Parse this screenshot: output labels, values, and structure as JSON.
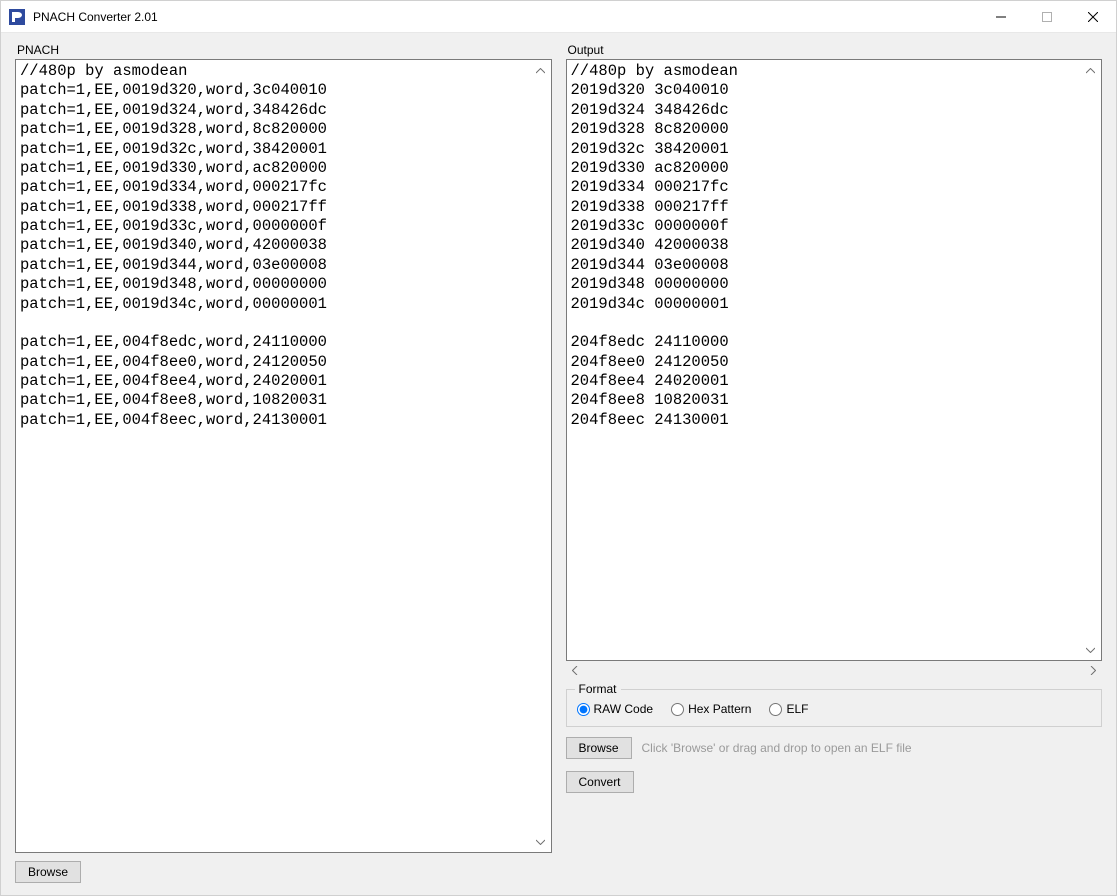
{
  "window": {
    "title": "PNACH Converter 2.01"
  },
  "labels": {
    "pnach": "PNACH",
    "output": "Output"
  },
  "format": {
    "legend": "Format",
    "options": {
      "raw": "RAW Code",
      "hex": "Hex Pattern",
      "elf": "ELF"
    },
    "selected": "raw"
  },
  "elf": {
    "browse": "Browse",
    "hint": "Click 'Browse' or drag and drop to open an ELF file"
  },
  "buttons": {
    "browse_left": "Browse",
    "convert": "Convert"
  },
  "pnach_text": "//480p by asmodean\npatch=1,EE,0019d320,word,3c040010\npatch=1,EE,0019d324,word,348426dc\npatch=1,EE,0019d328,word,8c820000\npatch=1,EE,0019d32c,word,38420001\npatch=1,EE,0019d330,word,ac820000\npatch=1,EE,0019d334,word,000217fc\npatch=1,EE,0019d338,word,000217ff\npatch=1,EE,0019d33c,word,0000000f\npatch=1,EE,0019d340,word,42000038\npatch=1,EE,0019d344,word,03e00008\npatch=1,EE,0019d348,word,00000000\npatch=1,EE,0019d34c,word,00000001\n\npatch=1,EE,004f8edc,word,24110000\npatch=1,EE,004f8ee0,word,24120050\npatch=1,EE,004f8ee4,word,24020001\npatch=1,EE,004f8ee8,word,10820031\npatch=1,EE,004f8eec,word,24130001",
  "output_text": "//480p by asmodean\n2019d320 3c040010\n2019d324 348426dc\n2019d328 8c820000\n2019d32c 38420001\n2019d330 ac820000\n2019d334 000217fc\n2019d338 000217ff\n2019d33c 0000000f\n2019d340 42000038\n2019d344 03e00008\n2019d348 00000000\n2019d34c 00000001\n\n204f8edc 24110000\n204f8ee0 24120050\n204f8ee4 24020001\n204f8ee8 10820031\n204f8eec 24130001"
}
